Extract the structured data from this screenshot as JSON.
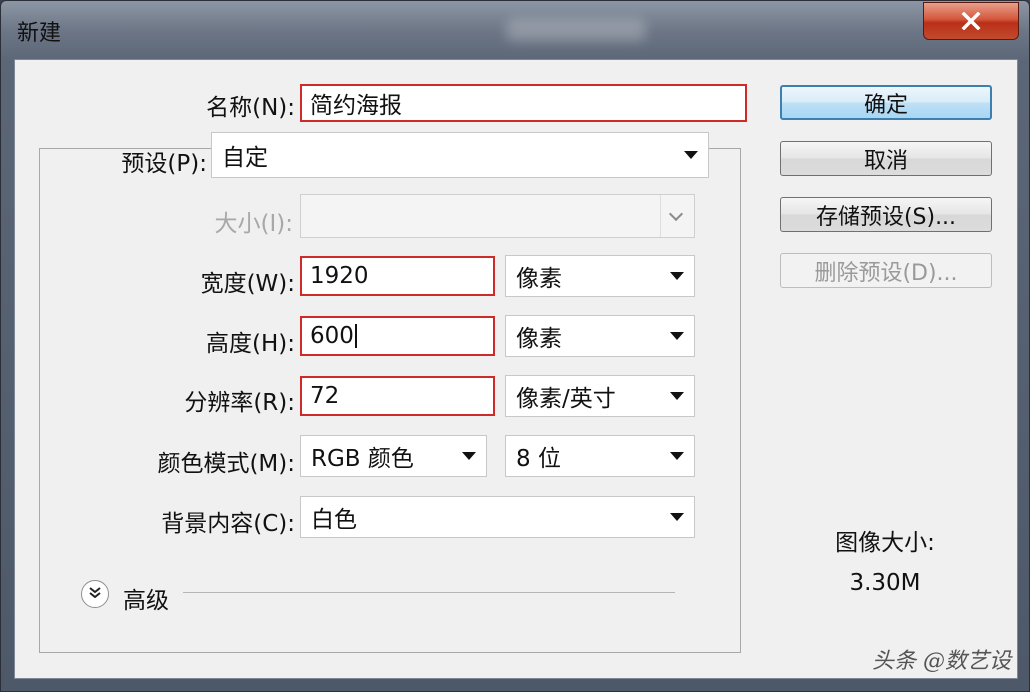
{
  "window": {
    "title": "新建"
  },
  "form": {
    "name": {
      "label": "名称(N):",
      "value": "简约海报"
    },
    "preset": {
      "label": "预设(P):",
      "value": "自定"
    },
    "size": {
      "label": "大小(I):",
      "value": ""
    },
    "width": {
      "label": "宽度(W):",
      "value": "1920",
      "unit": "像素"
    },
    "height": {
      "label": "高度(H):",
      "value": "600",
      "unit": "像素"
    },
    "resolution": {
      "label": "分辨率(R):",
      "value": "72",
      "unit": "像素/英寸"
    },
    "color_mode": {
      "label": "颜色模式(M):",
      "value": "RGB 颜色",
      "depth": "8 位"
    },
    "background": {
      "label": "背景内容(C):",
      "value": "白色"
    },
    "advanced": {
      "label": "高级"
    }
  },
  "buttons": {
    "ok": "确定",
    "cancel": "取消",
    "save_preset": "存储预设(S)...",
    "delete_preset": "删除预设(D)..."
  },
  "image_size": {
    "label": "图像大小:",
    "value": "3.30M"
  },
  "watermark": "头条 @数艺设",
  "colors": {
    "highlight": "#cf2a2a",
    "default_button_border": "#3c7fb1",
    "close_button": "#c44a2c"
  }
}
